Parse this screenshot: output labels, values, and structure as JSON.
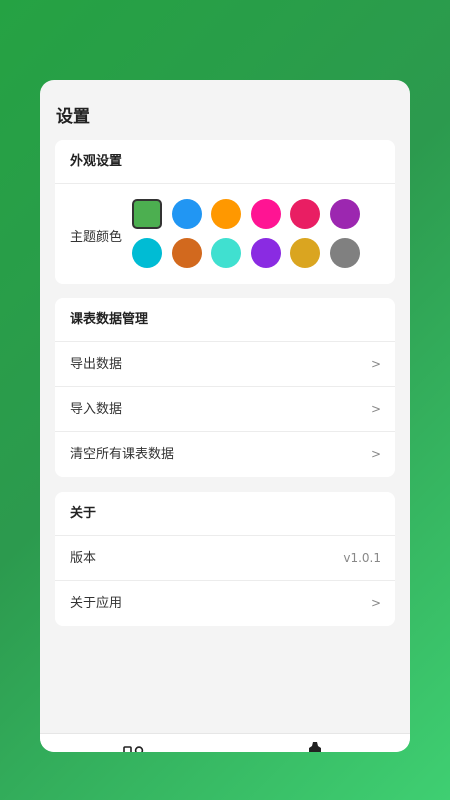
{
  "page": {
    "title": "设置"
  },
  "appearance": {
    "header": "外观设置",
    "theme_label": "主题颜色",
    "colors": [
      "#4caf50",
      "#2196f3",
      "#ff9800",
      "#ff1493",
      "#e91e63",
      "#9c27b0",
      "#00bcd4",
      "#d2691e",
      "#40e0d0",
      "#8a2be2",
      "#daa520",
      "#808080"
    ],
    "selected_index": 0
  },
  "data_mgmt": {
    "header": "课表数据管理",
    "items": [
      {
        "label": "导出数据",
        "chevron": ">"
      },
      {
        "label": "导入数据",
        "chevron": ">"
      },
      {
        "label": "清空所有课表数据",
        "chevron": ">"
      }
    ]
  },
  "about": {
    "header": "关于",
    "version_label": "版本",
    "version_value": "v1.0.1",
    "about_label": "关于应用",
    "chevron": ">"
  },
  "nav": {
    "icons": [
      "grid-icon",
      "gear-icon"
    ]
  }
}
